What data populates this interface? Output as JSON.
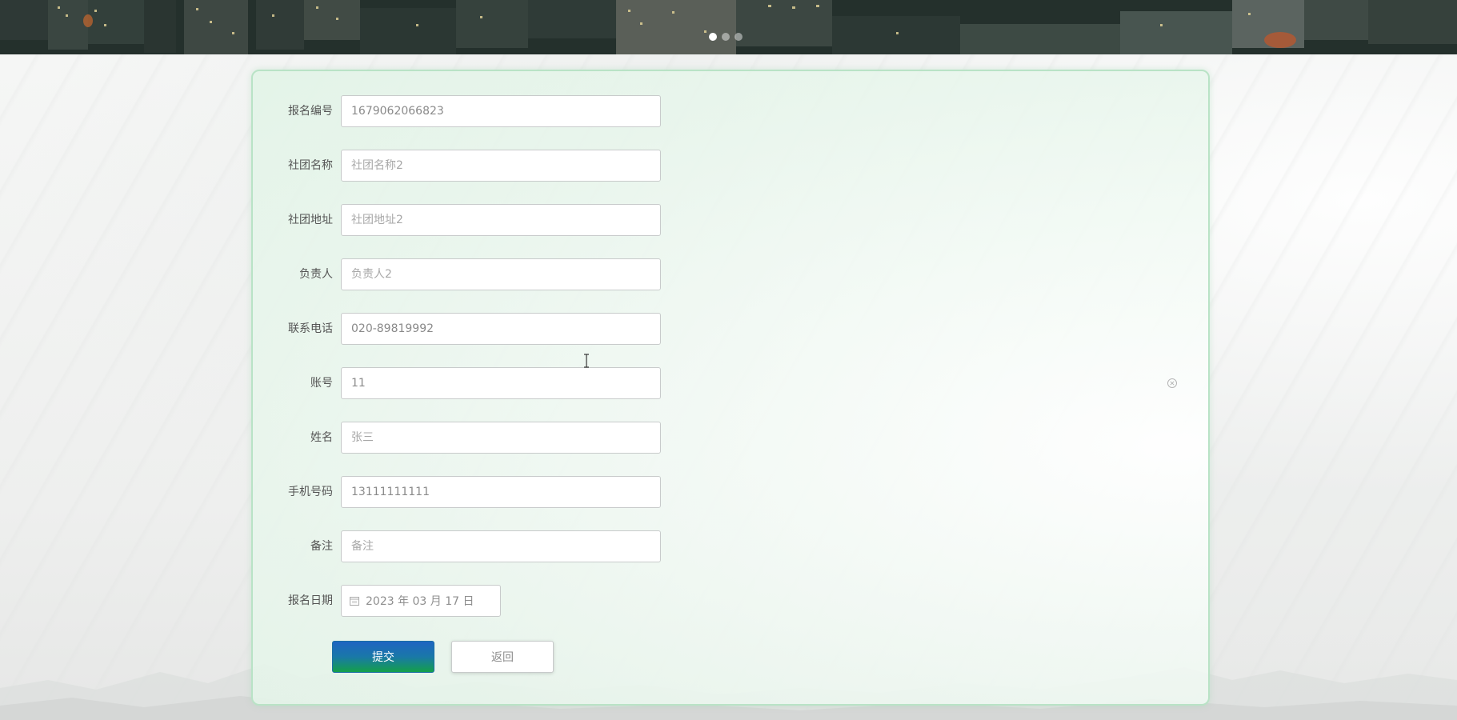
{
  "banner": {
    "carousel_dots": 3,
    "active_dot": 0
  },
  "form": {
    "fields": [
      {
        "label": "报名编号",
        "value": "1679062066823",
        "placeholder": ""
      },
      {
        "label": "社团名称",
        "value": "",
        "placeholder": "社团名称2"
      },
      {
        "label": "社团地址",
        "value": "",
        "placeholder": "社团地址2"
      },
      {
        "label": "负责人",
        "value": "",
        "placeholder": "负责人2"
      },
      {
        "label": "联系电话",
        "value": "020-89819992",
        "placeholder": ""
      },
      {
        "label": "账号",
        "value": "11",
        "placeholder": ""
      },
      {
        "label": "姓名",
        "value": "",
        "placeholder": "张三"
      },
      {
        "label": "手机号码",
        "value": "13111111111",
        "placeholder": ""
      },
      {
        "label": "备注",
        "value": "",
        "placeholder": "备注"
      }
    ],
    "date": {
      "label": "报名日期",
      "value": "2023 年 03 月 17 日"
    },
    "submit_label": "提交",
    "back_label": "返回"
  },
  "icons": {
    "date": "calendar-icon",
    "clear": "circle-close-icon",
    "cursor": "text-cursor-icon"
  },
  "colors": {
    "card_border": "#b9e3c6",
    "submit_top": "#1f64c2",
    "submit_bottom": "#14a04a"
  }
}
